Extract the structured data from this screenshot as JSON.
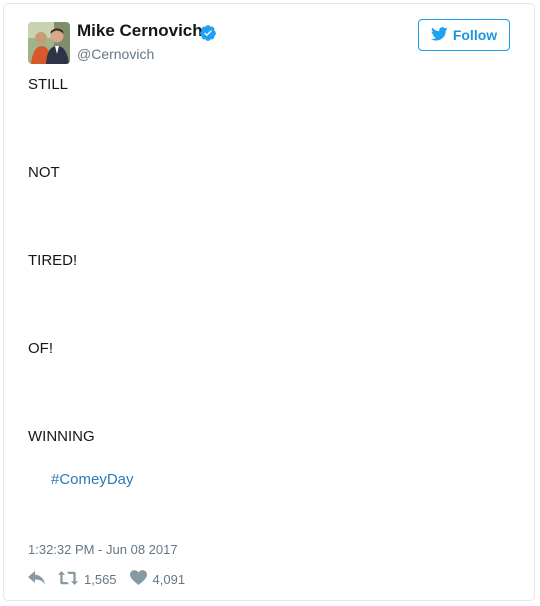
{
  "author": {
    "name": "Mike Cernovich",
    "handle": "@Cernovich",
    "verified": true
  },
  "follow_button": {
    "label": "Follow",
    "icon": "twitter-bird-icon"
  },
  "tweet": {
    "lines": [
      "STILL",
      "NOT",
      "TIRED!",
      "OF!",
      "WINNING"
    ],
    "hashtag": "#ComeyDay",
    "timestamp": "1:32:32 PM - Jun 08 2017"
  },
  "actions": {
    "reply_icon": "reply-icon",
    "retweet_icon": "retweet-icon",
    "retweet_count": "1,565",
    "like_icon": "heart-icon",
    "like_count": "4,091"
  },
  "colors": {
    "accent": "#1da1f2",
    "link": "#2b7bb9",
    "secondary_text": "#657786",
    "border": "#e1e8ed",
    "verified_badge": "#1da1f2"
  }
}
